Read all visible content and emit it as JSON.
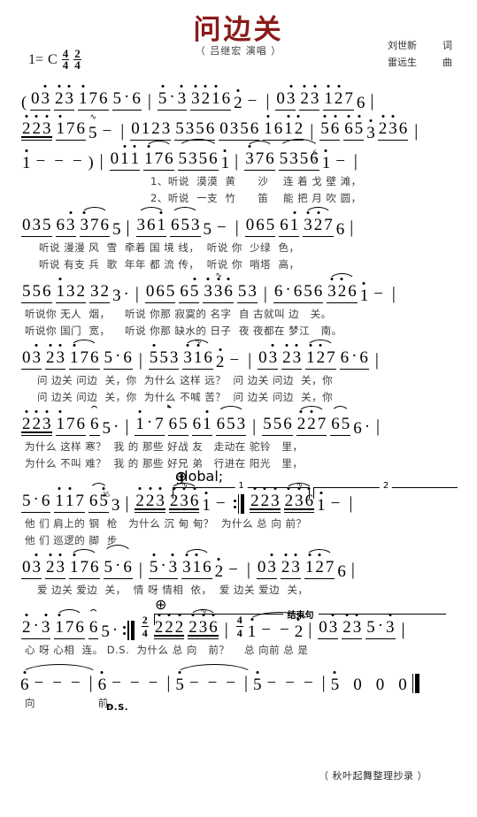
{
  "header": {
    "title": "问边关",
    "singer": "（ 吕继宏  演唱 ）",
    "key_label": "1=",
    "key_value": "C",
    "time_sig_1": {
      "num": "4",
      "den": "4"
    },
    "time_sig_2": {
      "num": "2",
      "den": "4"
    },
    "lyricist_name": "刘世新",
    "lyricist_role": "词",
    "composer_name": "雷远生",
    "composer_role": "曲"
  },
  "notation": {
    "type": "jianpu",
    "systems": [
      {
        "id": "system-1",
        "notes_text": "( 03 23 176 5·6 | 5·3 3216 2 − | 03 23 127 6 |",
        "lyrics": []
      },
      {
        "id": "system-2",
        "notes_text": "223 176 5 − |0123 5356 0356 1612 |56 65 3 236 |",
        "lyrics": []
      },
      {
        "id": "system-3",
        "notes_text": "1 − − − ) | 011 176 5356 1 | 376 5356 1 − |",
        "lyrics": [
          "1、听说  漠漠  黄      沙    连 着 戈 壁 滩，",
          "2、听说  一支  竹      笛    能 把 月 吹 圆，"
        ]
      },
      {
        "id": "system-4",
        "notes_text": "035 63 376 5 | 361 653 5 − | 065 61 327 6 |",
        "lyrics": [
          "听说 漫漫 风  雪  牵着 国 境 线，  听说 你  少绿  色，",
          "听说 有支 兵  歌  年年 都 流 传，  听说 你  哨塔  高，"
        ]
      },
      {
        "id": "system-5",
        "notes_text": "556 132 32 3· |065 65 336 53 | 6·656 326 1 − |",
        "lyrics": [
          "听说你 无人  烟，    听说 你那 寂寞的 名字  自 古就叫 边   关。",
          "听说你 国门  宽，    听说 你那 缺水的 日子  夜 夜都在 梦江   南。"
        ]
      },
      {
        "id": "system-6",
        "notes_text": "03 23 176 5·6 | 553 316 2 − | 03 23 127 6·6 |",
        "lyrics": [
          "问 边关 问边  关，你  为什么 这样 远？  问 边关 问边  关，你",
          "问 边关 问边  关，你  为什么 不喊 苦？  问 边关 问边  关，你"
        ]
      },
      {
        "id": "system-7",
        "notes_text": "223 176 6 5· | 1·7 65 61 653 | 556 227 65 6· |",
        "lyrics": [
          "为什么 这样 寒？  我 的 那些 好战 友   走动在 驼铃   里，",
          "为什么 不叫 难？  我 的 那些 好兄 弟   行进在 阳光   里，"
        ],
        "marking": "segno"
      },
      {
        "id": "system-8",
        "notes_text": "5·6 117 65 3 | 223 236 1 − :‖ 223 236 1 − |",
        "lyrics": [
          "他 们 肩上的 钢  枪   为什么 沉 甸 甸？  为什么 总 向 前？",
          "他 们 巡逻的 脚  步"
        ],
        "marking": "coda",
        "voltas": [
          "1",
          "2"
        ]
      },
      {
        "id": "system-9",
        "notes_text": "03 23 176 5·6 | 5·3 316 2 − | 03 23 127 6 |",
        "lyrics": [
          "爱 边关 爱边  关，  情 呀 情相  依，  爱 边关 爱边  关，"
        ]
      },
      {
        "id": "system-10",
        "notes_text": "2·3 176 6 5· :‖ 2/4 222 236 | 4/4 1 − − 2 | 03 23 5·3 |",
        "lyrics": [
          "心 呀 心相  连。 D.S.  为什么 总 向   前？    总 向前 总 是"
        ],
        "marking": "coda-ending",
        "coda_label": "结束句",
        "ds_label": "D.S."
      },
      {
        "id": "system-11",
        "notes_text": "6 − − − | 6 − − − | 5 − − − | 5 − − − | 5 0 0 0 ‖",
        "lyrics": [
          "向                 前。"
        ]
      }
    ]
  },
  "footer": {
    "credit": "（ 秋叶起舞整理抄录 ）"
  },
  "colors": {
    "title": "#8b1a1a",
    "notation": "#000000",
    "lyrics": "#3c3c3c",
    "background": "#ffffff"
  }
}
